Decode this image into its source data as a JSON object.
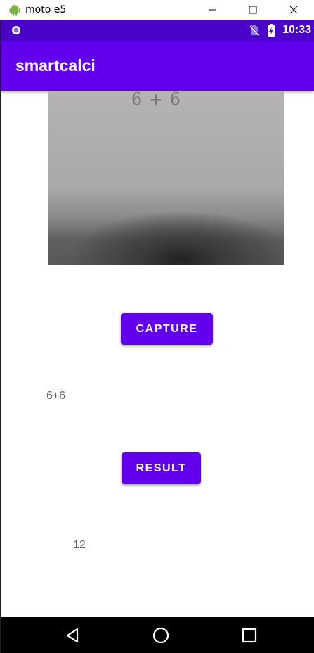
{
  "window": {
    "title": "moto e5"
  },
  "status_bar": {
    "time": "10:33"
  },
  "app_bar": {
    "title": "smartcalci"
  },
  "camera_preview": {
    "paper_text": "6 + 6"
  },
  "capture_button": {
    "label": "CAPTURE"
  },
  "recognized_text": "6+6",
  "result_button": {
    "label": "RESULT"
  },
  "result_value": "12",
  "colors": {
    "primary": "#6200ee",
    "primary_dark": "#4a04c9",
    "nav_bar": "#000000"
  },
  "icons": [
    "android-icon",
    "minimize-icon",
    "maximize-icon",
    "close-icon",
    "notification-dot-icon",
    "no-sim-icon",
    "battery-charging-icon",
    "back-icon",
    "home-icon",
    "recents-icon"
  ]
}
